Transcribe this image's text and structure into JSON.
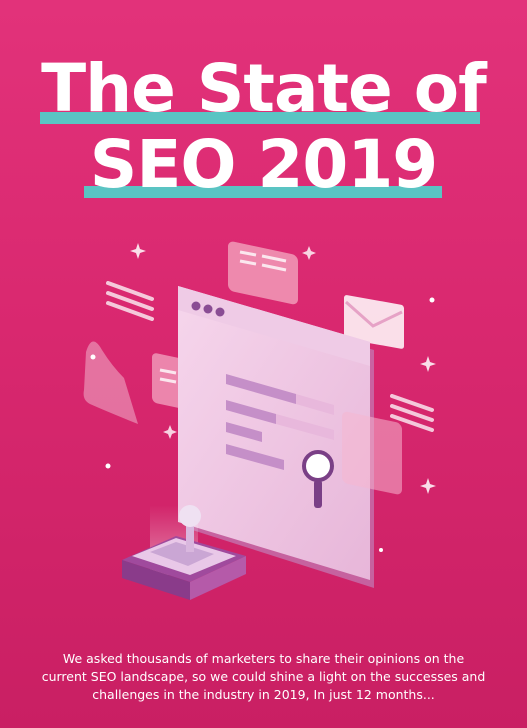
{
  "poster": {
    "title_line1": "The State of",
    "title_line2": "SEO 2019",
    "intro_text": "We asked thousands of marketers to share their opinions on the current SEO landscape, so we could shine a light on the successes and challenges in the industry in 2019, In just 12 months...",
    "colors": {
      "background": "#d9286f",
      "underline_accent": "#5ac4c3",
      "text": "#ffffff"
    }
  },
  "illustration": {
    "icons": [
      "browser-window-icon",
      "magnifier-icon",
      "envelope-icon",
      "chat-card-icon",
      "joystick-icon",
      "sparkle-icon"
    ]
  }
}
